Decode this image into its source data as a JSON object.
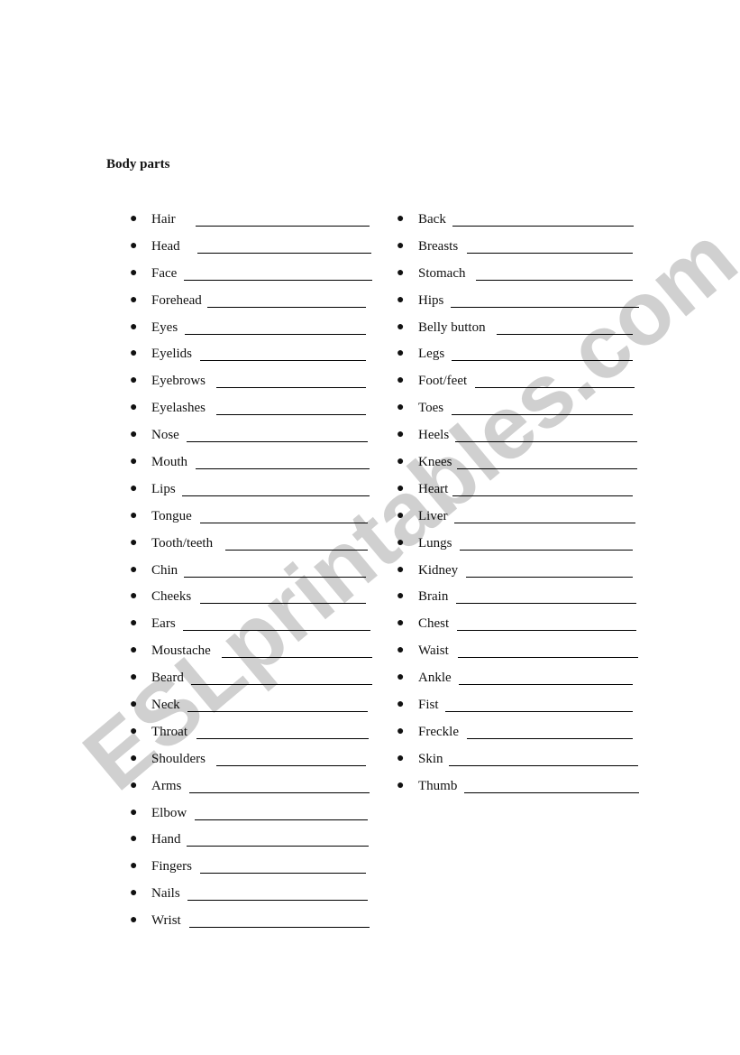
{
  "title": "Body parts",
  "watermark": "ESLprintables.com",
  "left_column": [
    {
      "label": "Hair",
      "line": [
        217,
        410
      ]
    },
    {
      "label": "Head",
      "line": [
        219,
        412
      ]
    },
    {
      "label": "Face",
      "line": [
        204,
        413
      ]
    },
    {
      "label": "Forehead",
      "line": [
        230,
        406
      ]
    },
    {
      "label": "Eyes",
      "line": [
        205,
        406
      ]
    },
    {
      "label": "Eyelids",
      "line": [
        222,
        406
      ]
    },
    {
      "label": "Eyebrows",
      "line": [
        240,
        406
      ]
    },
    {
      "label": "Eyelashes",
      "line": [
        240,
        406
      ]
    },
    {
      "label": "Nose",
      "line": [
        207,
        408
      ]
    },
    {
      "label": "Mouth",
      "line": [
        217,
        410
      ]
    },
    {
      "label": "Lips",
      "line": [
        202,
        410
      ]
    },
    {
      "label": "Tongue",
      "line": [
        222,
        408
      ]
    },
    {
      "label": "Tooth/teeth",
      "line": [
        250,
        408
      ]
    },
    {
      "label": "Chin",
      "line": [
        204,
        406
      ]
    },
    {
      "label": "Cheeks",
      "line": [
        222,
        406
      ]
    },
    {
      "label": "Ears",
      "line": [
        203,
        411
      ]
    },
    {
      "label": "Moustache",
      "line": [
        246,
        413
      ]
    },
    {
      "label": "Beard",
      "line": [
        212,
        413
      ]
    },
    {
      "label": "Neck",
      "line": [
        208,
        408
      ]
    },
    {
      "label": "Throat",
      "line": [
        218,
        409
      ]
    },
    {
      "label": "Shoulders",
      "line": [
        240,
        406
      ]
    },
    {
      "label": "Arms",
      "line": [
        210,
        410
      ]
    },
    {
      "label": "Elbow",
      "line": [
        216,
        408
      ]
    },
    {
      "label": "Hand",
      "line": [
        207,
        409
      ]
    },
    {
      "label": "Fingers",
      "line": [
        222,
        406
      ]
    },
    {
      "label": "Nails",
      "line": [
        208,
        408
      ]
    },
    {
      "label": "Wrist",
      "line": [
        210,
        410
      ]
    }
  ],
  "right_column": [
    {
      "label": "Back",
      "line": [
        502,
        703
      ]
    },
    {
      "label": "Breasts",
      "line": [
        518,
        702
      ]
    },
    {
      "label": "Stomach",
      "line": [
        528,
        702
      ]
    },
    {
      "label": "Hips",
      "line": [
        500,
        709
      ]
    },
    {
      "label": "Belly button",
      "line": [
        551,
        702
      ]
    },
    {
      "label": "Legs",
      "line": [
        501,
        702
      ]
    },
    {
      "label": "Foot/feet",
      "line": [
        527,
        704
      ]
    },
    {
      "label": "Toes",
      "line": [
        501,
        702
      ]
    },
    {
      "label": "Heels",
      "line": [
        505,
        707
      ]
    },
    {
      "label": "Knees",
      "line": [
        507,
        707
      ]
    },
    {
      "label": "Heart",
      "line": [
        502,
        702
      ]
    },
    {
      "label": "Liver",
      "line": [
        504,
        705
      ]
    },
    {
      "label": "Lungs",
      "line": [
        510,
        702
      ]
    },
    {
      "label": "Kidney",
      "line": [
        517,
        702
      ]
    },
    {
      "label": "Brain",
      "line": [
        506,
        706
      ]
    },
    {
      "label": "Chest",
      "line": [
        507,
        706
      ]
    },
    {
      "label": "Waist",
      "line": [
        508,
        708
      ]
    },
    {
      "label": "Ankle",
      "line": [
        509,
        702
      ]
    },
    {
      "label": "Fist",
      "line": [
        494,
        702
      ]
    },
    {
      "label": "Freckle",
      "line": [
        518,
        702
      ]
    },
    {
      "label": "Skin",
      "line": [
        498,
        708
      ]
    },
    {
      "label": "Thumb",
      "line": [
        515,
        709
      ]
    }
  ]
}
